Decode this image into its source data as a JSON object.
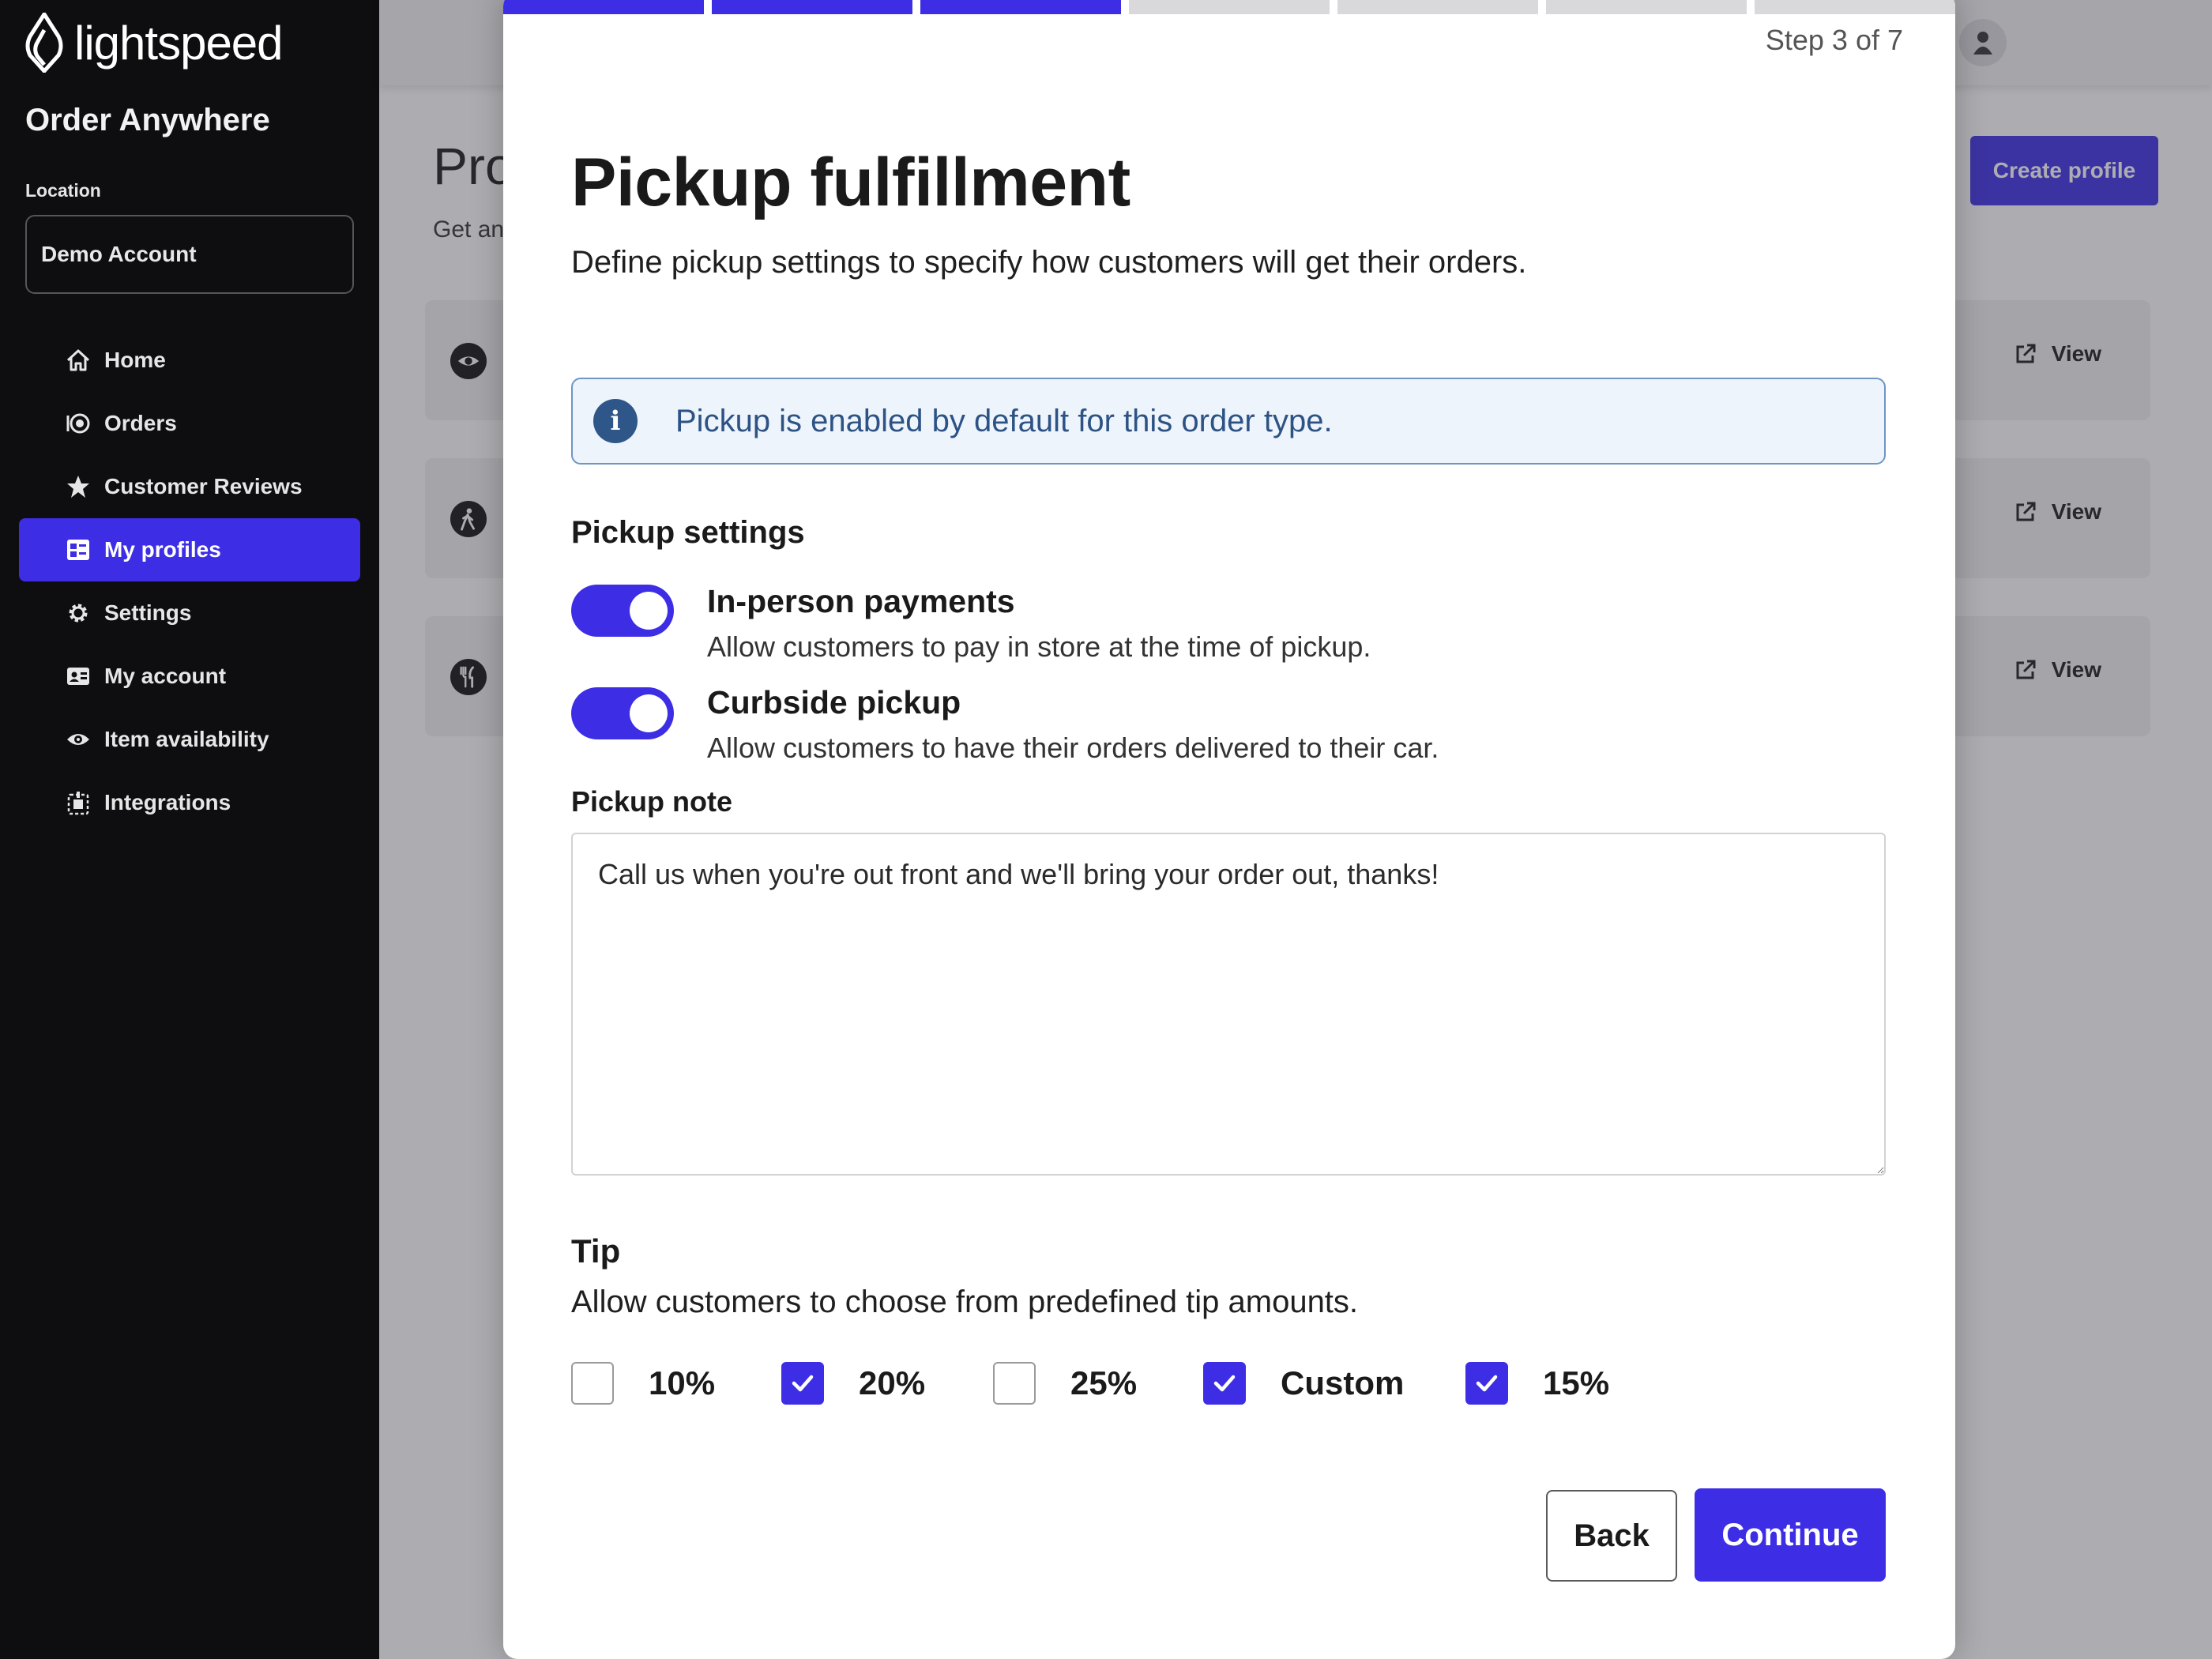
{
  "sidebar": {
    "brand": "lightspeed",
    "app_name": "Order Anywhere",
    "location_label": "Location",
    "location_value": "Demo Account",
    "items": [
      {
        "label": "Home",
        "icon": "home-icon"
      },
      {
        "label": "Orders",
        "icon": "orders-icon"
      },
      {
        "label": "Customer Reviews",
        "icon": "star-icon"
      },
      {
        "label": "My profiles",
        "icon": "profiles-icon",
        "active": true
      },
      {
        "label": "Settings",
        "icon": "gear-icon"
      },
      {
        "label": "My account",
        "icon": "id-card-icon"
      },
      {
        "label": "Item availability",
        "icon": "eye-icon"
      },
      {
        "label": "Integrations",
        "icon": "integrations-icon"
      }
    ]
  },
  "background": {
    "page_title": "Pro",
    "page_subtitle": "Get an",
    "create_button": "Create profile",
    "cards": [
      {
        "icon": "eye-icon",
        "view_label": "View"
      },
      {
        "icon": "walking-person-icon",
        "view_label": "View"
      },
      {
        "icon": "utensils-icon",
        "view_label": "View"
      }
    ]
  },
  "modal": {
    "step_text": "Step 3 of 7",
    "progress": {
      "current": 3,
      "total": 7
    },
    "title": "Pickup fulfillment",
    "subtitle": "Define pickup settings to specify how customers will get their orders.",
    "info_message": "Pickup is enabled by default for this order type.",
    "pickup_settings_title": "Pickup settings",
    "options": [
      {
        "title": "In-person payments",
        "description": "Allow customers to pay in store at the time of pickup.",
        "enabled": true
      },
      {
        "title": "Curbside pickup",
        "description": "Allow customers to have their orders delivered to their car.",
        "enabled": true
      }
    ],
    "pickup_note_label": "Pickup note",
    "pickup_note_value": "Call us when you're out front and we'll bring your order out, thanks!",
    "tip_title": "Tip",
    "tip_subtitle": "Allow customers to choose from predefined tip amounts.",
    "tip_options": [
      {
        "label": "10%",
        "checked": false
      },
      {
        "label": "20%",
        "checked": true
      },
      {
        "label": "25%",
        "checked": false
      },
      {
        "label": "Custom",
        "checked": true
      },
      {
        "label": "15%",
        "checked": true
      }
    ],
    "back_button": "Back",
    "continue_button": "Continue"
  },
  "colors": {
    "accent": "#3d2ee6",
    "sidebar_bg": "#0e0e10",
    "info_bg": "#eef4fb",
    "info_text": "#2d5385",
    "progress_inactive": "#d9d9dc"
  }
}
